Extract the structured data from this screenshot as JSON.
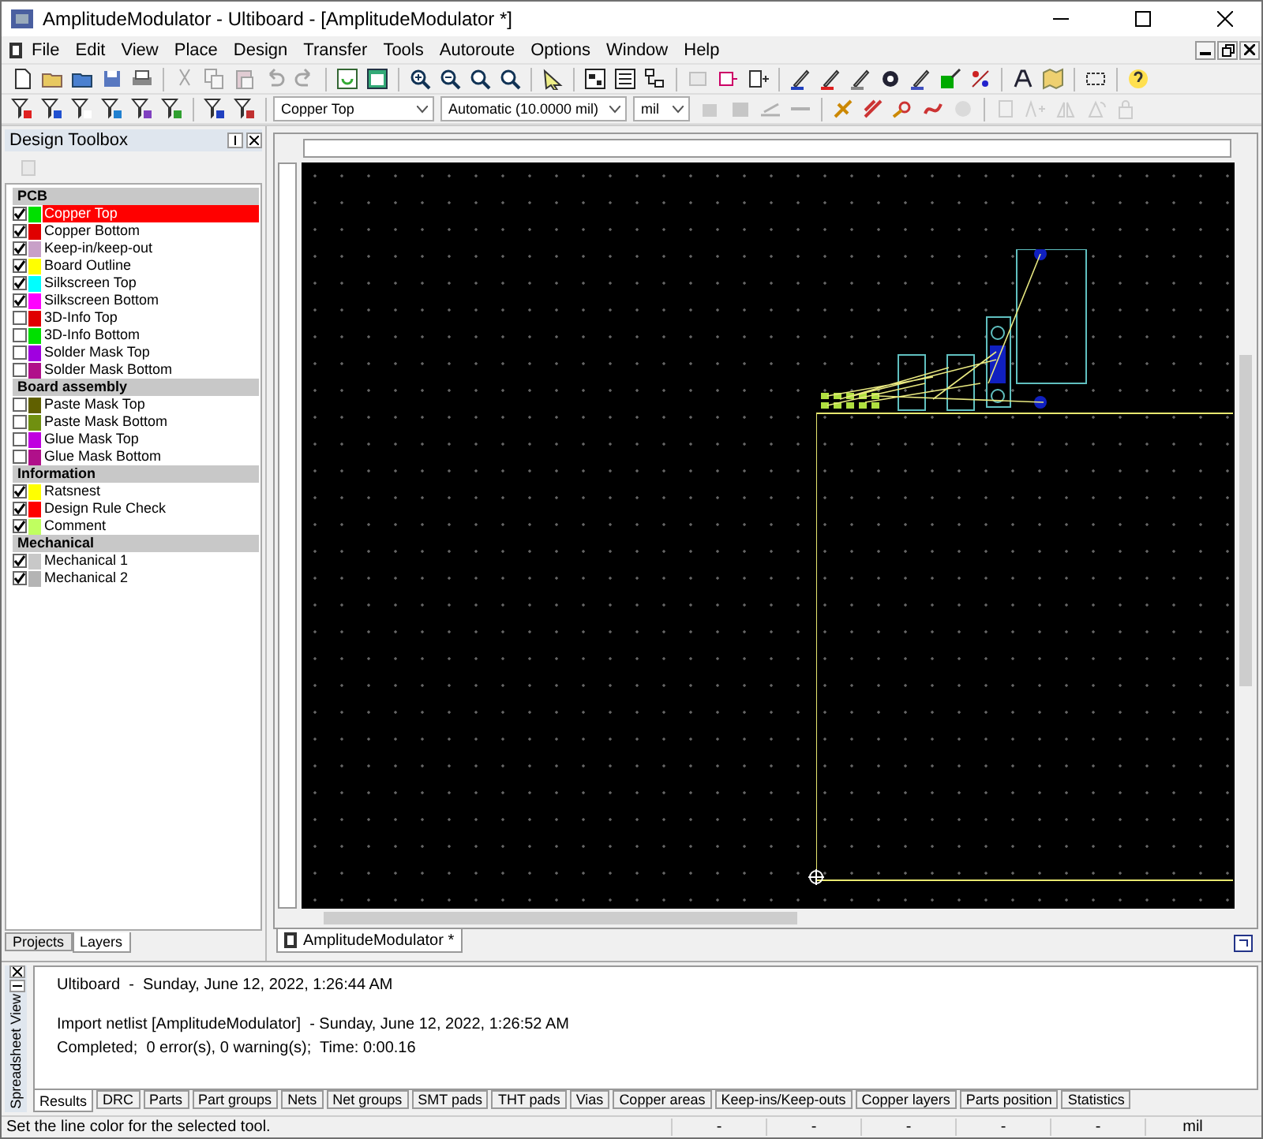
{
  "window": {
    "title": "AmplitudeModulator - Ultiboard - [AmplitudeModulator *]"
  },
  "menu": [
    "File",
    "Edit",
    "View",
    "Place",
    "Design",
    "Transfer",
    "Tools",
    "Autoroute",
    "Options",
    "Window",
    "Help"
  ],
  "toolbar": {
    "layer_select": "Copper Top",
    "grid_select": "Automatic (10.0000 mil)",
    "unit_select": "mil"
  },
  "design_toolbox": {
    "title": "Design Toolbox",
    "groups": [
      {
        "name": "PCB",
        "layers": [
          {
            "label": "Copper Top",
            "checked": true,
            "color": "#00e000",
            "selected": true
          },
          {
            "label": "Copper Bottom",
            "checked": true,
            "color": "#e00000",
            "selected": false
          },
          {
            "label": "Keep-in/keep-out",
            "checked": true,
            "color": "#c8a0c8",
            "selected": false
          },
          {
            "label": "Board Outline",
            "checked": true,
            "color": "#ffff00",
            "selected": false
          },
          {
            "label": "Silkscreen Top",
            "checked": true,
            "color": "#00ffff",
            "selected": false
          },
          {
            "label": "Silkscreen Bottom",
            "checked": true,
            "color": "#ff00ff",
            "selected": false
          },
          {
            "label": "3D-Info Top",
            "checked": false,
            "color": "#e00000",
            "selected": false
          },
          {
            "label": "3D-Info Bottom",
            "checked": false,
            "color": "#00e000",
            "selected": false
          },
          {
            "label": "Solder Mask Top",
            "checked": false,
            "color": "#a000e0",
            "selected": false
          },
          {
            "label": "Solder Mask Bottom",
            "checked": false,
            "color": "#b0108a",
            "selected": false
          }
        ]
      },
      {
        "name": "Board assembly",
        "layers": [
          {
            "label": "Paste Mask Top",
            "checked": false,
            "color": "#606000",
            "selected": false
          },
          {
            "label": "Paste Mask Bottom",
            "checked": false,
            "color": "#709010",
            "selected": false
          },
          {
            "label": "Glue Mask Top",
            "checked": false,
            "color": "#c000e0",
            "selected": false
          },
          {
            "label": "Glue Mask Bottom",
            "checked": false,
            "color": "#b0108a",
            "selected": false
          }
        ]
      },
      {
        "name": "Information",
        "layers": [
          {
            "label": "Ratsnest",
            "checked": true,
            "color": "#ffff00",
            "selected": false
          },
          {
            "label": "Design Rule Check",
            "checked": true,
            "color": "#ff0000",
            "selected": false
          },
          {
            "label": "Comment",
            "checked": true,
            "color": "#c0ff60",
            "selected": false
          }
        ]
      },
      {
        "name": "Mechanical",
        "layers": [
          {
            "label": "Mechanical 1",
            "checked": true,
            "color": "#c8c8c8",
            "selected": false
          },
          {
            "label": "Mechanical 2",
            "checked": true,
            "color": "#b4b4b4",
            "selected": false
          }
        ]
      }
    ],
    "tabs": [
      {
        "label": "Projects",
        "selected": false
      },
      {
        "label": "Layers",
        "selected": true
      }
    ]
  },
  "document_tab": {
    "label": "AmplitudeModulator *"
  },
  "spreadsheet": {
    "title": "Spreadsheet View",
    "log": [
      [
        "Ultiboard  -  Sunday, June 12, 2022, 1:26:44 AM"
      ],
      [
        "Import netlist [AmplitudeModulator]  - Sunday, June 12, 2022, 1:26:52 AM",
        "Completed;  0 error(s), 0 warning(s);  Time: 0:00.16"
      ]
    ],
    "tabs": [
      {
        "label": "Results",
        "selected": true
      },
      {
        "label": "DRC",
        "selected": false
      },
      {
        "label": "Parts",
        "selected": false
      },
      {
        "label": "Part groups",
        "selected": false
      },
      {
        "label": "Nets",
        "selected": false
      },
      {
        "label": "Net groups",
        "selected": false
      },
      {
        "label": "SMT pads",
        "selected": false
      },
      {
        "label": "THT pads",
        "selected": false
      },
      {
        "label": "Vias",
        "selected": false
      },
      {
        "label": "Copper areas",
        "selected": false
      },
      {
        "label": "Keep-ins/Keep-outs",
        "selected": false
      },
      {
        "label": "Copper layers",
        "selected": false
      },
      {
        "label": "Parts position",
        "selected": false
      },
      {
        "label": "Statistics",
        "selected": false
      }
    ]
  },
  "status_bar": {
    "message": "Set the line color for the selected tool.",
    "fields": [
      "-",
      "-",
      "-",
      "-",
      "-",
      "mil"
    ]
  }
}
